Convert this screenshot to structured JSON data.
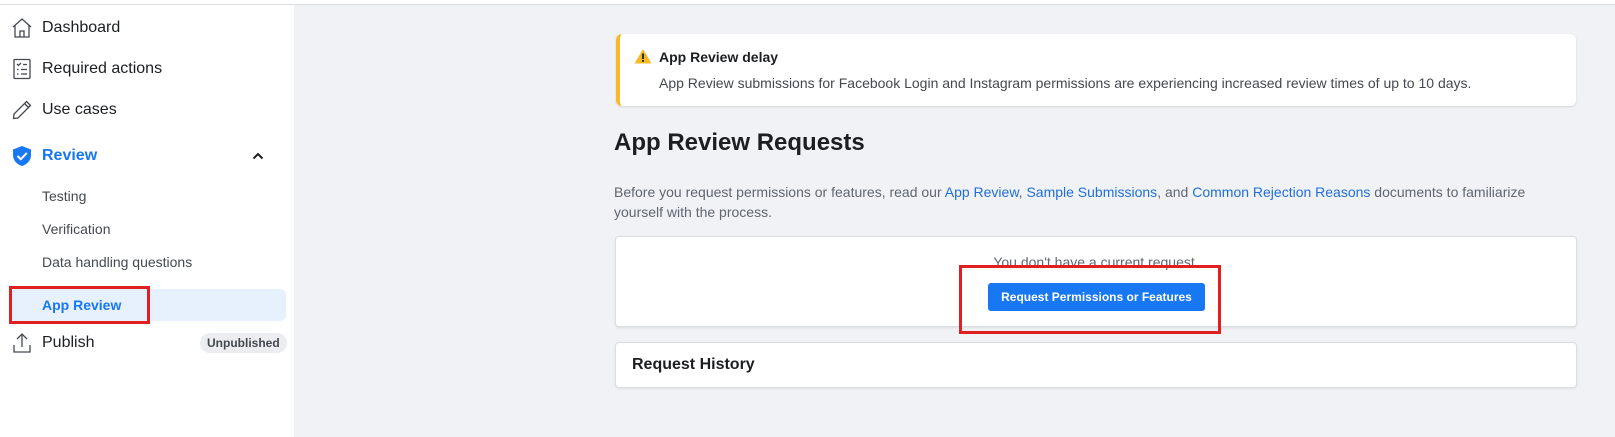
{
  "sidebar": {
    "items": [
      {
        "label": "Dashboard",
        "icon": "home-icon"
      },
      {
        "label": "Required actions",
        "icon": "checklist-icon"
      },
      {
        "label": "Use cases",
        "icon": "pencil-icon"
      },
      {
        "label": "Review",
        "icon": "shield-check-icon"
      },
      {
        "label": "Publish",
        "icon": "upload-icon"
      }
    ],
    "review_sub_items": [
      {
        "label": "Testing"
      },
      {
        "label": "Verification"
      },
      {
        "label": "Data handling questions"
      },
      {
        "label": "App Review"
      }
    ],
    "publish_badge": "Unpublished"
  },
  "alert": {
    "title": "App Review delay",
    "body": "App Review submissions for Facebook Login and Instagram permissions are experiencing increased review times of up to 10 days."
  },
  "main": {
    "title": "App Review Requests",
    "intro_prefix": "Before you request permissions or features, read our ",
    "link_app_review": "App Review",
    "sep1": ", ",
    "link_sample": "Sample Submissions",
    "sep2": ", and ",
    "link_rejection": "Common Rejection Reasons",
    "intro_suffix": " documents to familiarize yourself with the process.",
    "no_request_text": "You don't have a current request.",
    "request_button": "Request Permissions or Features",
    "history_title": "Request History"
  },
  "colors": {
    "accent": "#1877f2",
    "warning": "#f7b928",
    "highlight_box": "#e02020",
    "selected_bg": "#e7f0fd"
  }
}
